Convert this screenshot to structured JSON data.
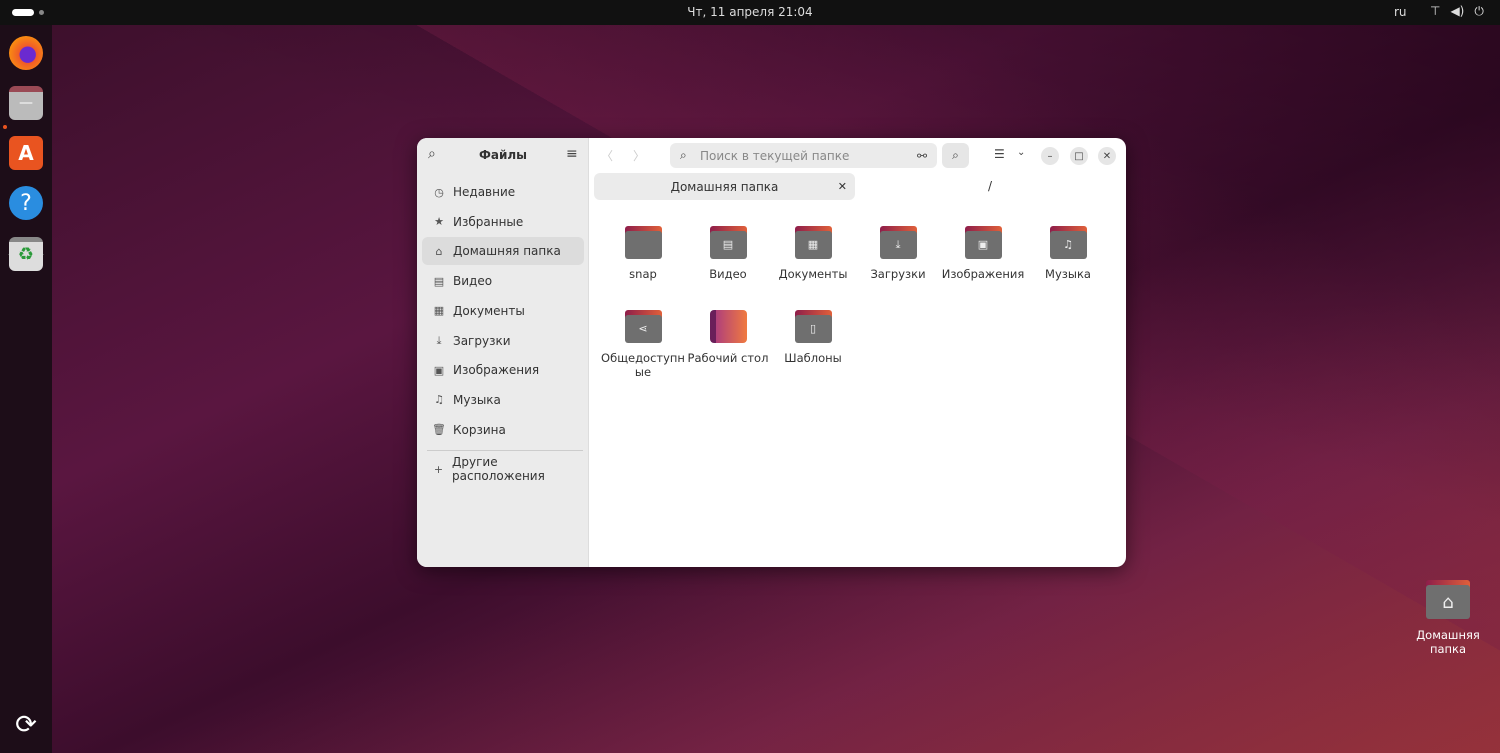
{
  "topbar": {
    "clock": "Чт, 11 апреля  21:04",
    "lang": "ru",
    "tray": [
      "network-icon",
      "volume-icon",
      "power-icon"
    ]
  },
  "dock": [
    "firefox",
    "files",
    "app-center",
    "help",
    "trash"
  ],
  "window": {
    "sidebar": {
      "title": "Файлы",
      "items": [
        {
          "label": "Недавние",
          "icon": "clock"
        },
        {
          "label": "Избранные",
          "icon": "star"
        },
        {
          "label": "Домашняя папка",
          "icon": "home",
          "selected": true
        },
        {
          "label": "Видео",
          "icon": "film"
        },
        {
          "label": "Документы",
          "icon": "document"
        },
        {
          "label": "Загрузки",
          "icon": "download"
        },
        {
          "label": "Изображения",
          "icon": "image"
        },
        {
          "label": "Музыка",
          "icon": "music"
        },
        {
          "label": "Корзина",
          "icon": "trash"
        }
      ],
      "other": "Другие расположения"
    },
    "search_placeholder": "Поиск в текущей папке",
    "tab": "Домашняя папка",
    "path": "/",
    "folders": [
      {
        "name": "snap",
        "glyph": ""
      },
      {
        "name": "Видео",
        "glyph": "▤"
      },
      {
        "name": "Документы",
        "glyph": "▦"
      },
      {
        "name": "Загрузки",
        "glyph": "⤓"
      },
      {
        "name": "Изображения",
        "glyph": "▣"
      },
      {
        "name": "Музыка",
        "glyph": "♫"
      },
      {
        "name": "Общедоступные",
        "glyph": "⋖"
      },
      {
        "name": "Рабочий стол",
        "glyph": "desktop"
      },
      {
        "name": "Шаблоны",
        "glyph": "▯"
      }
    ]
  },
  "desktop": {
    "home_label": "Домашняя папка"
  },
  "colors": {
    "accent": "#e95420"
  }
}
